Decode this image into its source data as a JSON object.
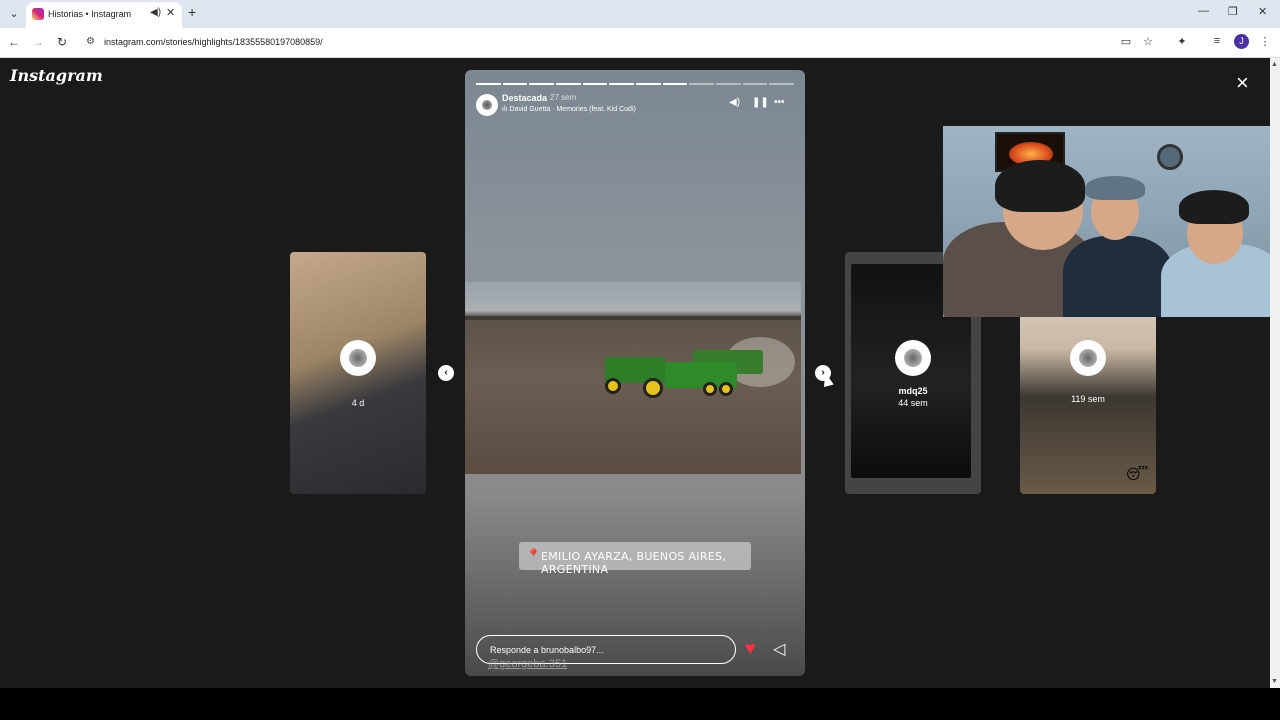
{
  "browser": {
    "tab_title": "Historias • Instagram",
    "url": "instagram.com/stories/highlights/18355580197080859/",
    "profile_initial": "J"
  },
  "page": {
    "logo": "Instagram"
  },
  "story": {
    "user": "Destacada",
    "time": "27 sem",
    "music": "David Guetta · Memories (feat. Kid Cudi)",
    "segments_total": 12,
    "segments_done": 8,
    "location": "EMILIO AYARZA, BUENOS AIRES, ARGENTINA",
    "reply_placeholder": "Responde a brunobalbo97...",
    "watermark": "@georgeba.351"
  },
  "previews": {
    "left": {
      "time": "4 d"
    },
    "right1": {
      "name": "mdq25",
      "time": "44 sem"
    },
    "right2": {
      "time": "119 sem"
    }
  },
  "icons": {
    "close": "×",
    "prev": "‹",
    "next": "›",
    "heart": "♥",
    "send": "➢",
    "pin": "⬤",
    "volume": "🔊",
    "pause": "❚❚",
    "more": "•••"
  }
}
